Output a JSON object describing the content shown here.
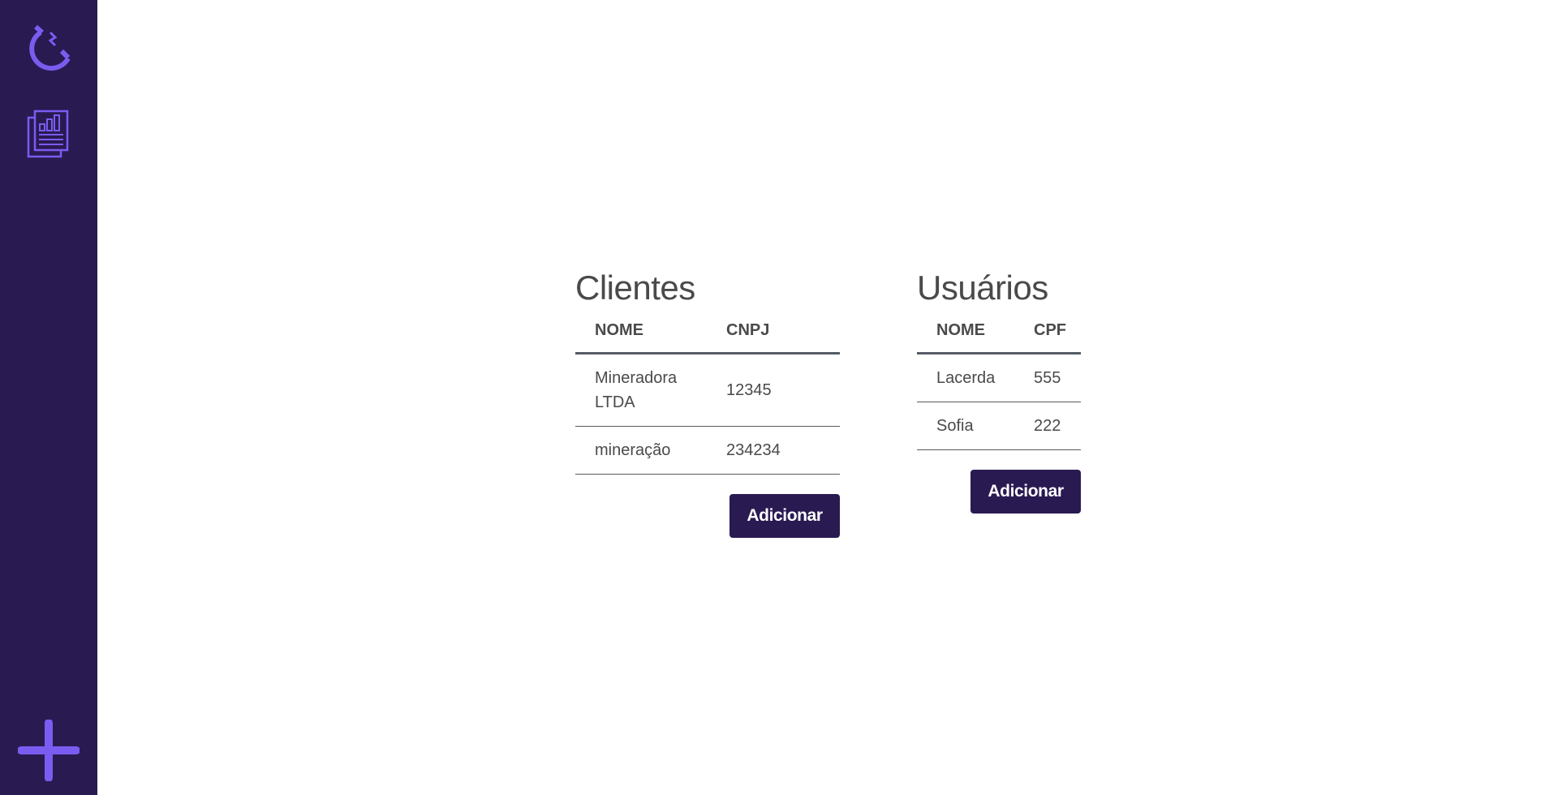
{
  "sidebar": {
    "items": [
      {
        "name": "logo",
        "icon": "magnet-icon"
      },
      {
        "name": "reports",
        "icon": "report-chart-icon"
      },
      {
        "name": "add",
        "icon": "plus-icon"
      }
    ],
    "accent": "#7b5cf0",
    "background": "#2a1a52"
  },
  "clients": {
    "title": "Clientes",
    "columns": [
      "NOME",
      "CNPJ"
    ],
    "rows": [
      {
        "nome": "Mineradora LTDA",
        "cnpj": "12345"
      },
      {
        "nome": "mineração",
        "cnpj": "234234"
      }
    ],
    "add_label": "Adicionar"
  },
  "users": {
    "title": "Usuários",
    "columns": [
      "NOME",
      "CPF"
    ],
    "rows": [
      {
        "nome": "Lacerda",
        "cpf": "555"
      },
      {
        "nome": "Sofia",
        "cpf": "222"
      }
    ],
    "add_label": "Adicionar"
  }
}
